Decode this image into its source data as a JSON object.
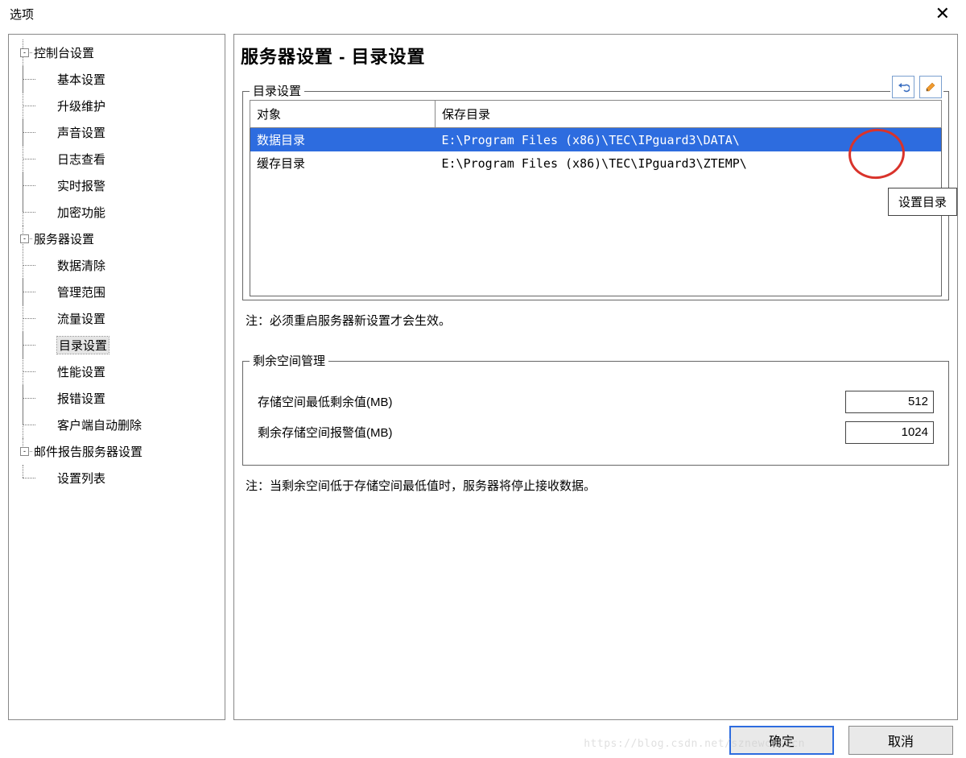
{
  "window": {
    "title": "选项"
  },
  "tree": {
    "nodes": [
      {
        "label": "控制台设置",
        "children": [
          "基本设置",
          "升级维护",
          "声音设置",
          "日志查看",
          "实时报警",
          "加密功能"
        ]
      },
      {
        "label": "服务器设置",
        "children": [
          "数据清除",
          "管理范围",
          "流量设置",
          "目录设置",
          "性能设置",
          "报错设置",
          "客户端自动删除"
        ],
        "selected_child": "目录设置"
      },
      {
        "label": "邮件报告服务器设置",
        "children": [
          "设置列表"
        ]
      }
    ]
  },
  "page": {
    "heading": "服务器设置 - 目录设置"
  },
  "dir_group": {
    "label": "目录设置",
    "columns": [
      "对象",
      "保存目录"
    ],
    "rows": [
      {
        "obj": "数据目录",
        "path": "E:\\Program Files (x86)\\TEC\\IPguard3\\DATA\\",
        "selected": true
      },
      {
        "obj": "缓存目录",
        "path": "E:\\Program Files (x86)\\TEC\\IPguard3\\ZTEMP\\",
        "selected": false
      }
    ],
    "note": "注：必须重启服务器新设置才会生效。"
  },
  "tooltip": "设置目录",
  "space_group": {
    "label": "剩余空间管理",
    "field1_label": "存储空间最低剩余值(MB)",
    "field1_value": "512",
    "field2_label": "剩余存储空间报警值(MB)",
    "field2_value": "1024",
    "note": "注：当剩余空间低于存储空间最低值时，服务器将停止接收数据。"
  },
  "buttons": {
    "ok": "确定",
    "cancel": "取消"
  },
  "watermark": "https://blog.csdn.net/sznewcasecn"
}
